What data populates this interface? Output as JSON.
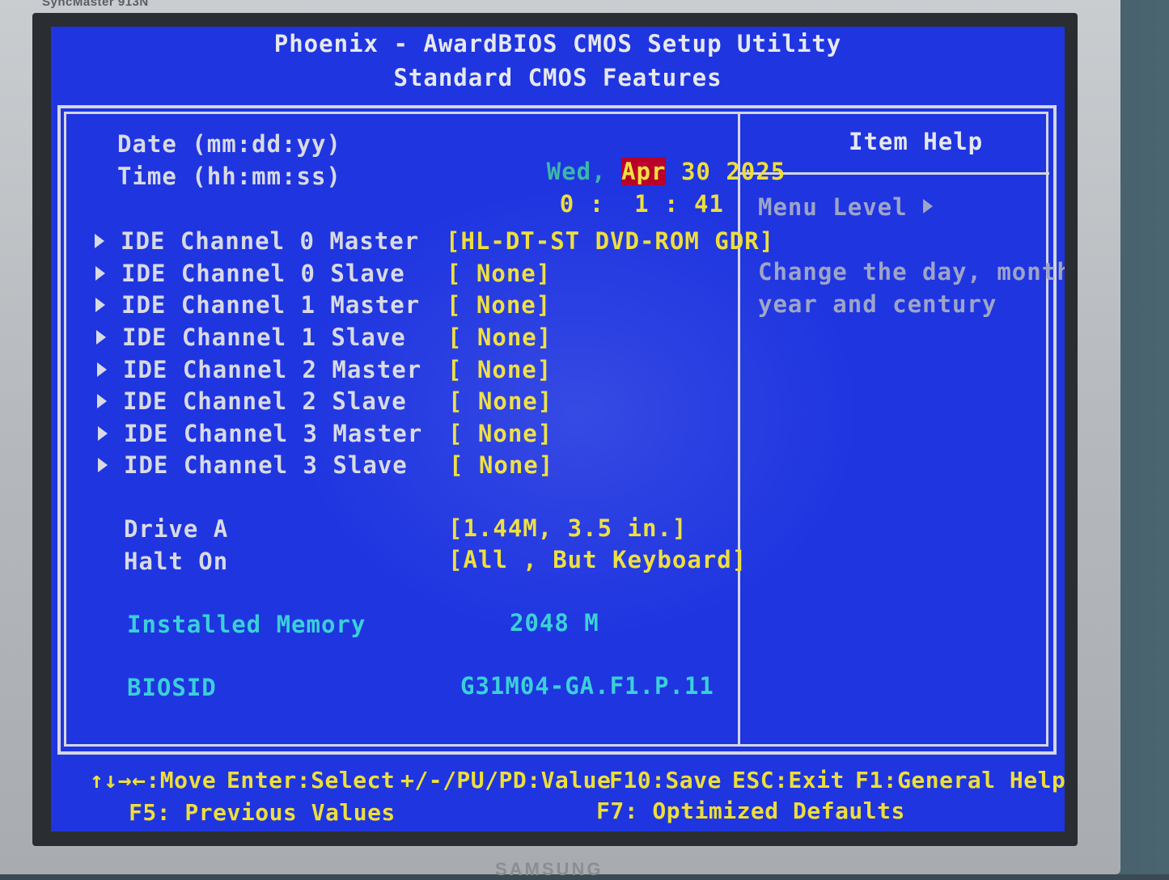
{
  "bezel": {
    "model": "SyncMaster 913N",
    "brand": "SAMSUNG"
  },
  "header": {
    "title": "Phoenix - AwardBIOS CMOS Setup Utility",
    "subtitle": "Standard CMOS Features"
  },
  "date": {
    "label": "Date (mm:dd:yy)",
    "weekday": "Wed,",
    "month": "Apr",
    "day": "30",
    "year": "2025"
  },
  "time": {
    "label": "Time (hh:mm:ss)",
    "hours": "0",
    "sep1": ":",
    "minutes": "1",
    "sep2": ":",
    "seconds": "41"
  },
  "ide_channels": [
    {
      "label": "IDE Channel 0 Master",
      "value": "[HL-DT-ST DVD-ROM GDR]"
    },
    {
      "label": "IDE Channel 0 Slave",
      "value": "[ None]"
    },
    {
      "label": "IDE Channel 1 Master",
      "value": "[ None]"
    },
    {
      "label": "IDE Channel 1 Slave",
      "value": "[ None]"
    },
    {
      "label": "IDE Channel 2 Master",
      "value": "[ None]"
    },
    {
      "label": "IDE Channel 2 Slave",
      "value": "[ None]"
    },
    {
      "label": "IDE Channel 3 Master",
      "value": "[ None]"
    },
    {
      "label": "IDE Channel 3 Slave",
      "value": "[ None]"
    }
  ],
  "drive_a": {
    "label": "Drive A",
    "value": "[1.44M, 3.5 in.]"
  },
  "halt_on": {
    "label": "Halt On",
    "value": "[All , But Keyboard]"
  },
  "installed_memory": {
    "label": "Installed Memory",
    "value": "2048 M"
  },
  "biosid": {
    "label": "BIOSID",
    "value": "G31M04-GA.F1.P.11"
  },
  "item_help": {
    "title": "Item Help",
    "menu_level": "Menu Level",
    "line1": "Change the day, month,",
    "line2": "year and century"
  },
  "footer": {
    "move": "↑↓→←:Move",
    "enter": "Enter:Select",
    "value": "+/-/PU/PD:Value",
    "save": "F10:Save",
    "exit": "ESC:Exit",
    "help": "F1:General Help",
    "prev": "F5: Previous Values",
    "optimized": "F7: Optimized Defaults"
  },
  "colors": {
    "background": "#1f35e0",
    "label": "#d8dae4",
    "value": "#eede3a",
    "info": "#3ad0d8",
    "selection": "#b8002a"
  }
}
